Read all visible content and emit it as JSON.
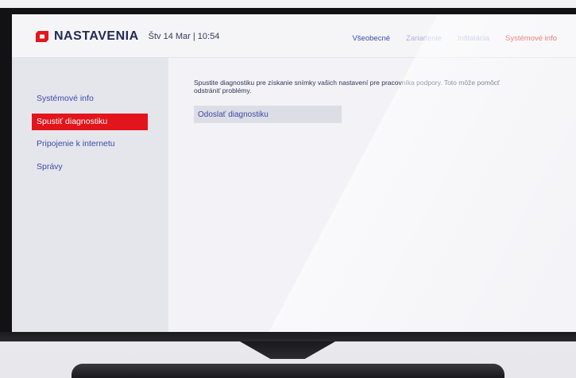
{
  "header": {
    "brand": "NASTAVENIA",
    "datetime": "Štv 14 Mar | 10:54",
    "logo_color": "#e2151c"
  },
  "tabs": [
    {
      "label": "Všeobecné"
    },
    {
      "label": "Zariadenie"
    },
    {
      "label": "Inštalácia"
    },
    {
      "label": "Systémové info",
      "active": true
    }
  ],
  "sidebar": {
    "items": [
      {
        "label": "Systémové info"
      },
      {
        "label": "Spustiť diagnostiku",
        "active": true
      },
      {
        "label": "Pripojenie k internetu"
      },
      {
        "label": "Správy"
      }
    ]
  },
  "main": {
    "description": "Spustite diagnostiku pre získanie snímky vašich nastavení pre pracovníka podpory. Toto môže pomôcť odstrániť problémy.",
    "send_button_label": "Odoslať diagnostiku"
  },
  "colors": {
    "accent_red": "#e2151c",
    "nav_blue": "#3b4aa8",
    "brand_navy": "#222a55"
  }
}
